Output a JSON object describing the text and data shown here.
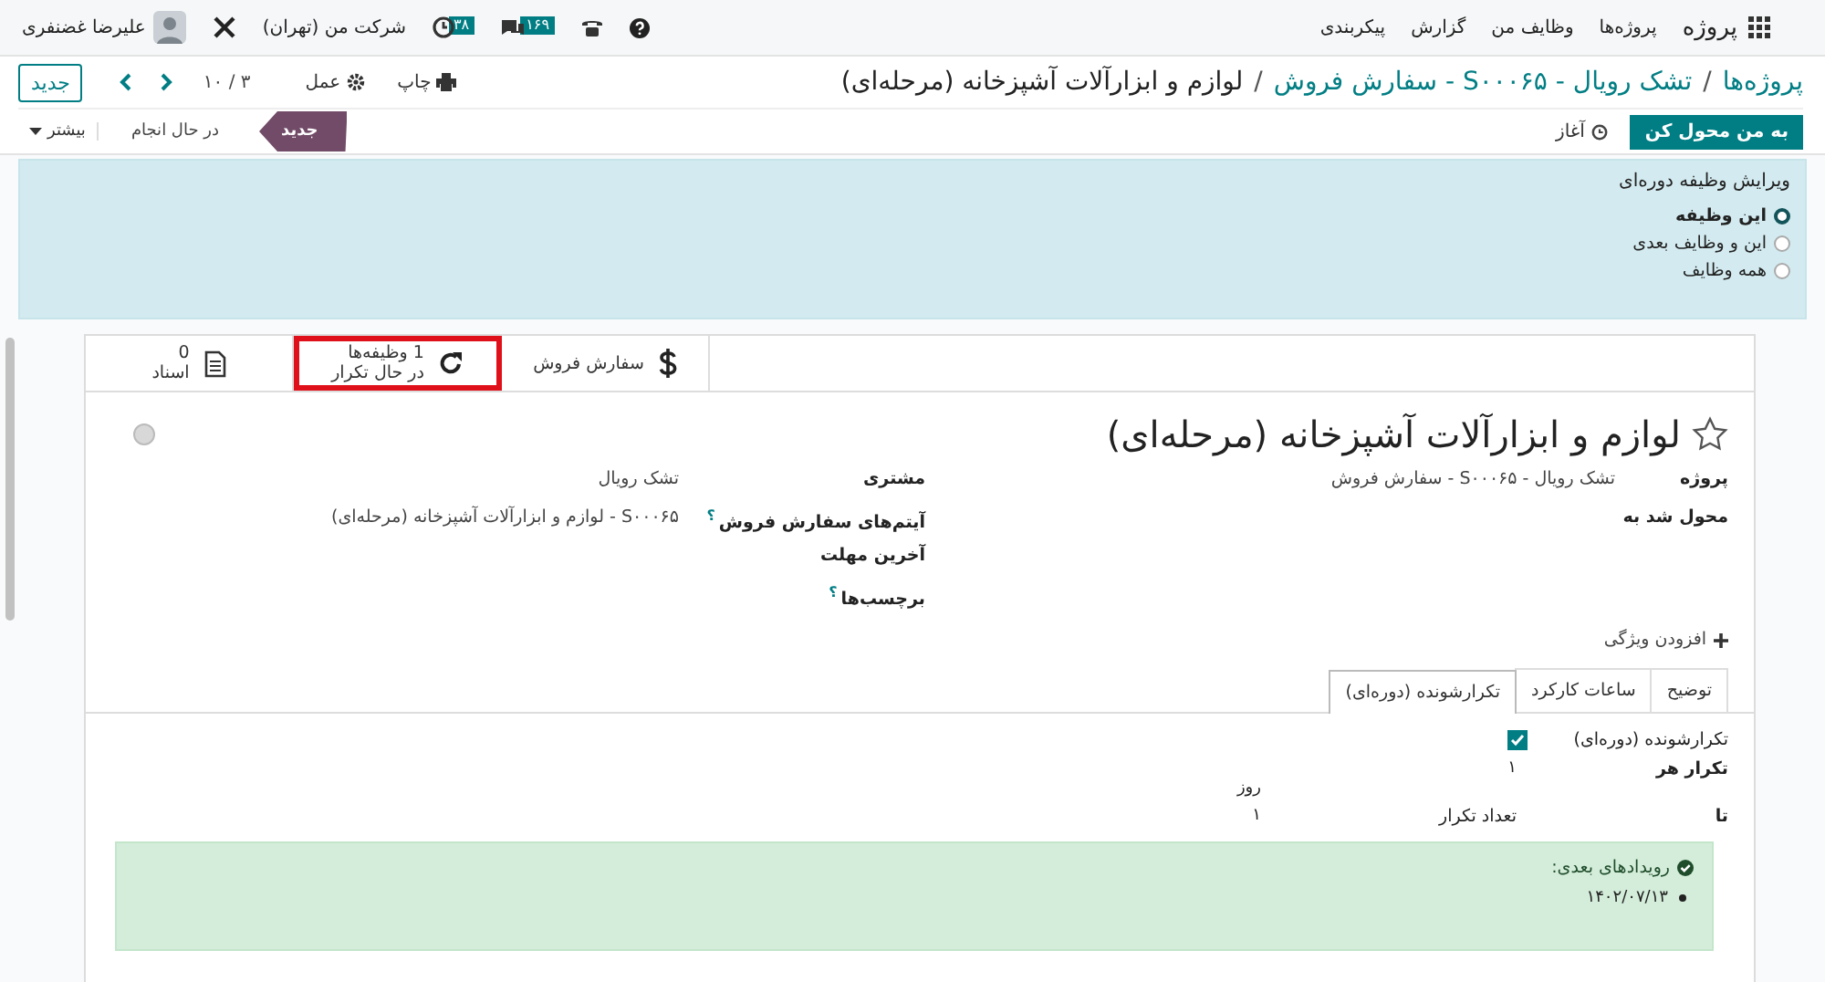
{
  "navbar": {
    "app_name": "پروژه",
    "menu": [
      "پروژه‌ها",
      "وظایف من",
      "گزارش",
      "پیکربندی"
    ],
    "messages_count": "۱۶۹",
    "activities_count": "۳۸",
    "company": "شرکت من (تهران)",
    "user": "علیرضا غضنفری"
  },
  "breadcrumb": {
    "separator": "/",
    "items": [
      {
        "label": "پروژه‌ها",
        "link": true
      },
      {
        "label": "تشک رویال - S۰۰۰۶۵ - سفارش فروش",
        "link": true
      },
      {
        "label": "لوازم و ابزارآلات آشپزخانه (مرحله‌ای)",
        "link": false
      }
    ]
  },
  "toolbar": {
    "print": "چاپ",
    "action": "عمل",
    "pager": "۳ / ۱۰",
    "new": "جدید"
  },
  "status": {
    "buttons": [
      {
        "label": "به من محول کن",
        "kind": "primary"
      },
      {
        "label": "آغاز",
        "kind": "timer"
      }
    ],
    "stages": [
      {
        "label": "جدید",
        "selected": true
      },
      {
        "label": "در حال انجام",
        "selected": false
      }
    ],
    "more": "بیشتر"
  },
  "recurrence_edit": {
    "title": "ویرایش وظیفه دوره‌ای",
    "options": [
      {
        "label": "این وظیفه",
        "selected": true
      },
      {
        "label": "این و وظایف بعدی",
        "selected": false
      },
      {
        "label": "همه وظایف",
        "selected": false
      }
    ]
  },
  "smart_buttons": [
    {
      "kind": "sale",
      "title": "سفارش فروش",
      "highlighted": false
    },
    {
      "kind": "recurrence",
      "title": "1 وظیفه‌ها",
      "subtitle": "در حال تکرار",
      "highlighted": true
    },
    {
      "kind": "documents",
      "title": "0",
      "subtitle": "اسناد",
      "highlighted": false
    }
  ],
  "task": {
    "title": "لوازم و ابزارآلات آشپزخانه (مرحله‌ای)",
    "starred": false,
    "fields_right": [
      {
        "label": "پروژه",
        "value": "تشک رویال - S۰۰۰۶۵ - سفارش فروش"
      },
      {
        "label": "محول شد به"
      }
    ],
    "fields_left": [
      {
        "label": "مشتری",
        "value": "تشک رویال"
      },
      {
        "label": "آیتم‌های سفارش فروش",
        "help": "؟",
        "value": "S۰۰۰۶۵ - لوازم و ابزارآلات آشپزخانه (مرحله‌ای)"
      },
      {
        "label": "آخرین مهلت"
      },
      {
        "label": "برچسب‌ها",
        "help": "؟"
      }
    ],
    "add_property": "افزودن ویژگی"
  },
  "tabs": [
    {
      "label": "توضیح",
      "selected": false
    },
    {
      "label": "ساعات کارکرد",
      "selected": false
    },
    {
      "label": "تکرارشونده (دوره‌ای)",
      "selected": true
    }
  ],
  "recurrence": {
    "checkbox": {
      "label": "تکرارشونده (دوره‌ای)",
      "checked": true
    },
    "repeat_label": "تکرار هر",
    "repeat_value": "۱",
    "repeat_unit": "روز",
    "until_label": "تا",
    "until_type": "تعداد تکرار",
    "until_value": "۱",
    "next_title": "رویدادهای بعدی:",
    "next_dates": [
      "۱۴۰۲/۰۷/۱۳"
    ]
  }
}
